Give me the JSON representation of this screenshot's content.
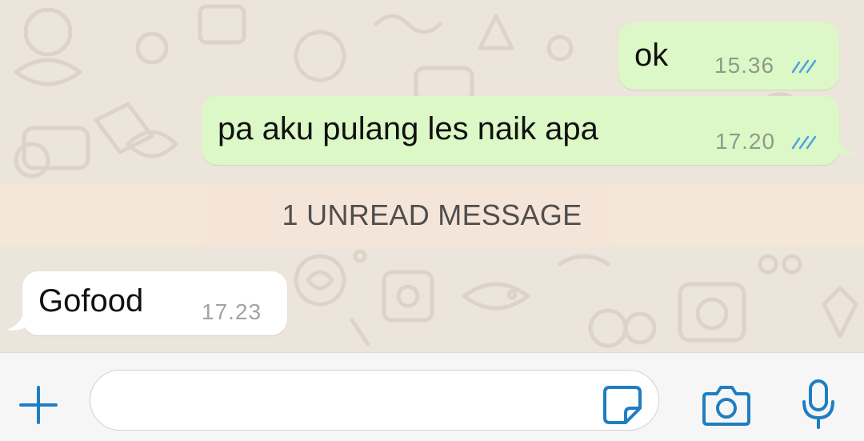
{
  "chat": {
    "messages": [
      {
        "direction": "outgoing",
        "text": "ok",
        "time": "15.36",
        "status": "read"
      },
      {
        "direction": "outgoing",
        "text": "pa aku pulang les naik apa",
        "time": "17.20",
        "status": "read"
      },
      {
        "direction": "incoming",
        "text": "Gofood",
        "time": "17.23"
      }
    ],
    "unread_banner": "1 UNREAD MESSAGE"
  },
  "composer": {
    "value": "",
    "placeholder": ""
  },
  "icons": {
    "attach": "plus-icon",
    "sticker": "sticker-icon",
    "camera": "camera-icon",
    "mic": "microphone-icon",
    "read_receipt": "double-check-icon"
  },
  "colors": {
    "wallpaper": "#ece5dc",
    "outgoing_bubble": "#dcf8c6",
    "incoming_bubble": "#ffffff",
    "unread_banner": "#f5e6d8",
    "accent": "#1f7ec2",
    "read_tick": "#4fa3e0"
  }
}
